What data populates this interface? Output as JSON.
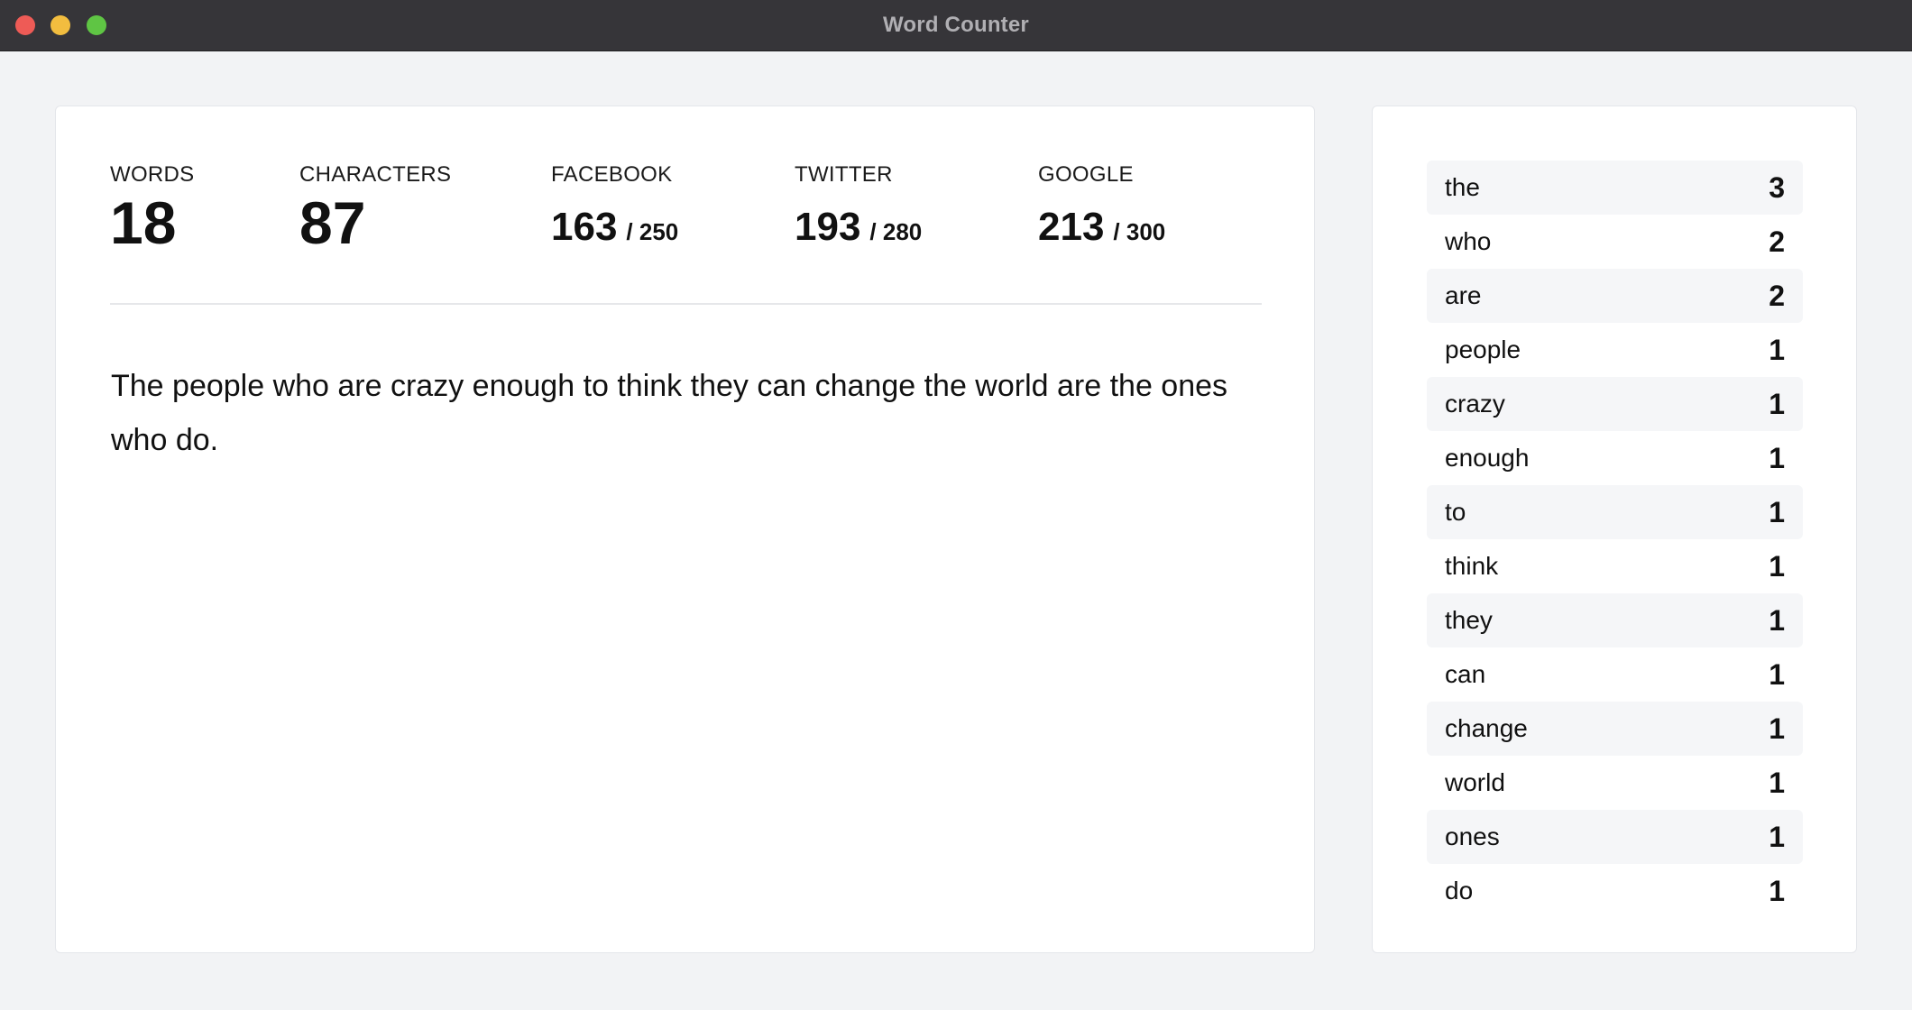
{
  "window": {
    "title": "Word Counter"
  },
  "stats": {
    "words": {
      "label": "WORDS",
      "value": "18"
    },
    "characters": {
      "label": "CHARACTERS",
      "value": "87"
    },
    "facebook": {
      "label": "FACEBOOK",
      "value": "163",
      "limit": "/ 250"
    },
    "twitter": {
      "label": "TWITTER",
      "value": "193",
      "limit": "/ 280"
    },
    "google": {
      "label": "GOOGLE",
      "value": "213",
      "limit": "/ 300"
    }
  },
  "editor": {
    "text": "The people who are crazy enough to think they can change the world are the ones who do."
  },
  "frequency": [
    {
      "word": "the",
      "count": "3"
    },
    {
      "word": "who",
      "count": "2"
    },
    {
      "word": "are",
      "count": "2"
    },
    {
      "word": "people",
      "count": "1"
    },
    {
      "word": "crazy",
      "count": "1"
    },
    {
      "word": "enough",
      "count": "1"
    },
    {
      "word": "to",
      "count": "1"
    },
    {
      "word": "think",
      "count": "1"
    },
    {
      "word": "they",
      "count": "1"
    },
    {
      "word": "can",
      "count": "1"
    },
    {
      "word": "change",
      "count": "1"
    },
    {
      "word": "world",
      "count": "1"
    },
    {
      "word": "ones",
      "count": "1"
    },
    {
      "word": "do",
      "count": "1"
    }
  ]
}
